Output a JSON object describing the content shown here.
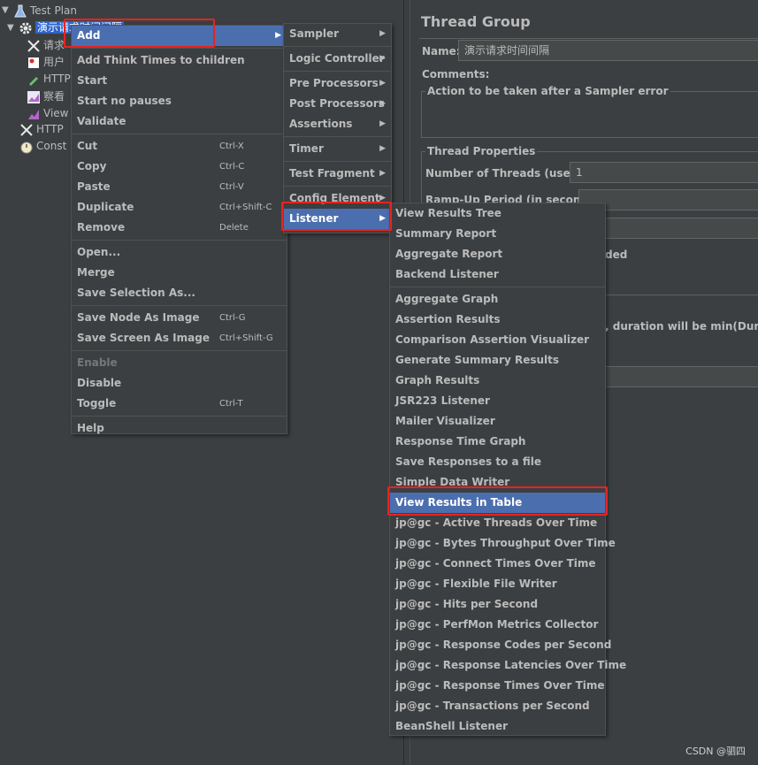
{
  "tree": {
    "test_plan": "Test Plan",
    "thread_group": "演示请求时间间隔",
    "children": [
      "请求",
      "用户",
      "HTTP",
      "察看",
      "View"
    ],
    "http": "HTTP",
    "constant": "Const"
  },
  "panel": {
    "title": "Thread Group",
    "name_label": "Name:",
    "name_value": "演示请求时间间隔",
    "comments_label": "Comments:",
    "error_action_title": "Action to be taken after a Sampler error",
    "thread_props_title": "Thread Properties",
    "threads_label": "Number of Threads (users):",
    "threads_value": "1",
    "rampup_label": "Ramp-Up Period (in seconds):",
    "partial_1": "ded",
    "partial_2": ", duration will be min(Duration,"
  },
  "context_menu": {
    "add": "Add",
    "add_think_times": "Add Think Times to children",
    "start": "Start",
    "start_no_pauses": "Start no pauses",
    "validate": "Validate",
    "cut": "Cut",
    "cut_sc": "Ctrl-X",
    "copy": "Copy",
    "copy_sc": "Ctrl-C",
    "paste": "Paste",
    "paste_sc": "Ctrl-V",
    "duplicate": "Duplicate",
    "duplicate_sc": "Ctrl+Shift-C",
    "remove": "Remove",
    "remove_sc": "Delete",
    "open": "Open...",
    "merge": "Merge",
    "save_selection": "Save Selection As...",
    "save_node_image": "Save Node As Image",
    "save_node_image_sc": "Ctrl-G",
    "save_screen_image": "Save Screen As Image",
    "save_screen_image_sc": "Ctrl+Shift-G",
    "enable": "Enable",
    "disable": "Disable",
    "toggle": "Toggle",
    "toggle_sc": "Ctrl-T",
    "help": "Help"
  },
  "add_menu": {
    "sampler": "Sampler",
    "logic_controller": "Logic Controller",
    "pre_processors": "Pre Processors",
    "post_processors": "Post Processors",
    "assertions": "Assertions",
    "timer": "Timer",
    "test_fragment": "Test Fragment",
    "config_element": "Config Element",
    "listener": "Listener"
  },
  "listener_menu": {
    "group1": [
      "View Results Tree",
      "Summary Report",
      "Aggregate Report",
      "Backend Listener"
    ],
    "group2": [
      "Aggregate Graph",
      "Assertion Results",
      "Comparison Assertion Visualizer",
      "Generate Summary Results",
      "Graph Results",
      "JSR223 Listener",
      "Mailer Visualizer",
      "Response Time Graph",
      "Save Responses to a file",
      "Simple Data Writer",
      "View Results in Table",
      "jp@gc - Active Threads Over Time",
      "jp@gc - Bytes Throughput Over Time",
      "jp@gc - Connect Times Over Time",
      "jp@gc - Flexible File Writer",
      "jp@gc - Hits per Second",
      "jp@gc - PerfMon Metrics Collector",
      "jp@gc - Response Codes per Second",
      "jp@gc - Response Latencies Over Time",
      "jp@gc - Response Times Over Time",
      "jp@gc - Transactions per Second",
      "BeanShell Listener"
    ]
  },
  "watermark": "CSDN @驷四",
  "colors": {
    "highlight": "#4b6eaf",
    "annotation": "#e8231f",
    "background": "#3c3f41"
  }
}
